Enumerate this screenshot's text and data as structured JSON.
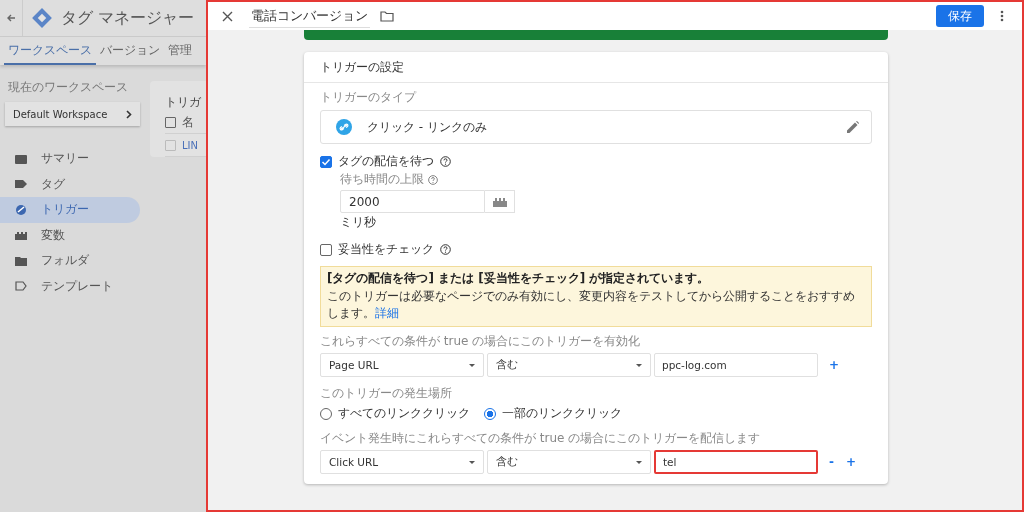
{
  "app": {
    "title": "タグ マネージャー",
    "tabs": [
      {
        "label": "ワークスペース",
        "selected": true
      },
      {
        "label": "バージョン",
        "selected": false
      },
      {
        "label": "管理",
        "selected": false
      }
    ],
    "workspace_label": "現在のワークスペース",
    "workspace_name": "Default Workspace",
    "nav": [
      {
        "label": "サマリー",
        "selected": false
      },
      {
        "label": "タグ",
        "selected": false
      },
      {
        "label": "トリガー",
        "selected": true
      },
      {
        "label": "変数",
        "selected": false
      },
      {
        "label": "フォルダ",
        "selected": false
      },
      {
        "label": "テンプレート",
        "selected": false
      }
    ],
    "list_card": {
      "title": "トリガ",
      "header": "名",
      "header_checked": false,
      "row": "LIN",
      "row_checked": false
    }
  },
  "editor": {
    "title": "電話コンバージョン",
    "save_button": "保存",
    "section_title": "トリガーの設定",
    "type_label": "トリガーのタイプ",
    "type_name": "クリック - リンクのみ",
    "wait": {
      "label": "タグの配信を待つ",
      "checked": true,
      "timeout_label": "待ち時間の上限",
      "value": "2000",
      "unit": "ミリ秒"
    },
    "validate": {
      "label": "妥当性をチェック",
      "checked": false
    },
    "warning": {
      "title": "[タグの配信を待つ] または [妥当性をチェック] が指定されています。",
      "text": "このトリガーは必要なページでのみ有効にし、変更内容をテストしてから公開することをおすすめします。",
      "link": "詳細"
    },
    "enable_label": "これらすべての条件が true の場合にこのトリガーを有効化",
    "enable_conditions": [
      {
        "variable": "Page URL",
        "operator": "含む",
        "value": "ppc-log.com",
        "highlighted": false,
        "actions": [
          "+"
        ]
      }
    ],
    "fire_label": "このトリガーの発生場所",
    "fire_options": [
      {
        "label": "すべてのリンククリック",
        "selected": false
      },
      {
        "label": "一部のリンククリック",
        "selected": true
      }
    ],
    "fire_conditions_label": "イベント発生時にこれらすべての条件が true の場合にこのトリガーを配信します",
    "fire_conditions": [
      {
        "variable": "Click URL",
        "operator": "含む",
        "value": "tel",
        "highlighted": true,
        "actions": [
          "-",
          "+"
        ]
      }
    ]
  }
}
